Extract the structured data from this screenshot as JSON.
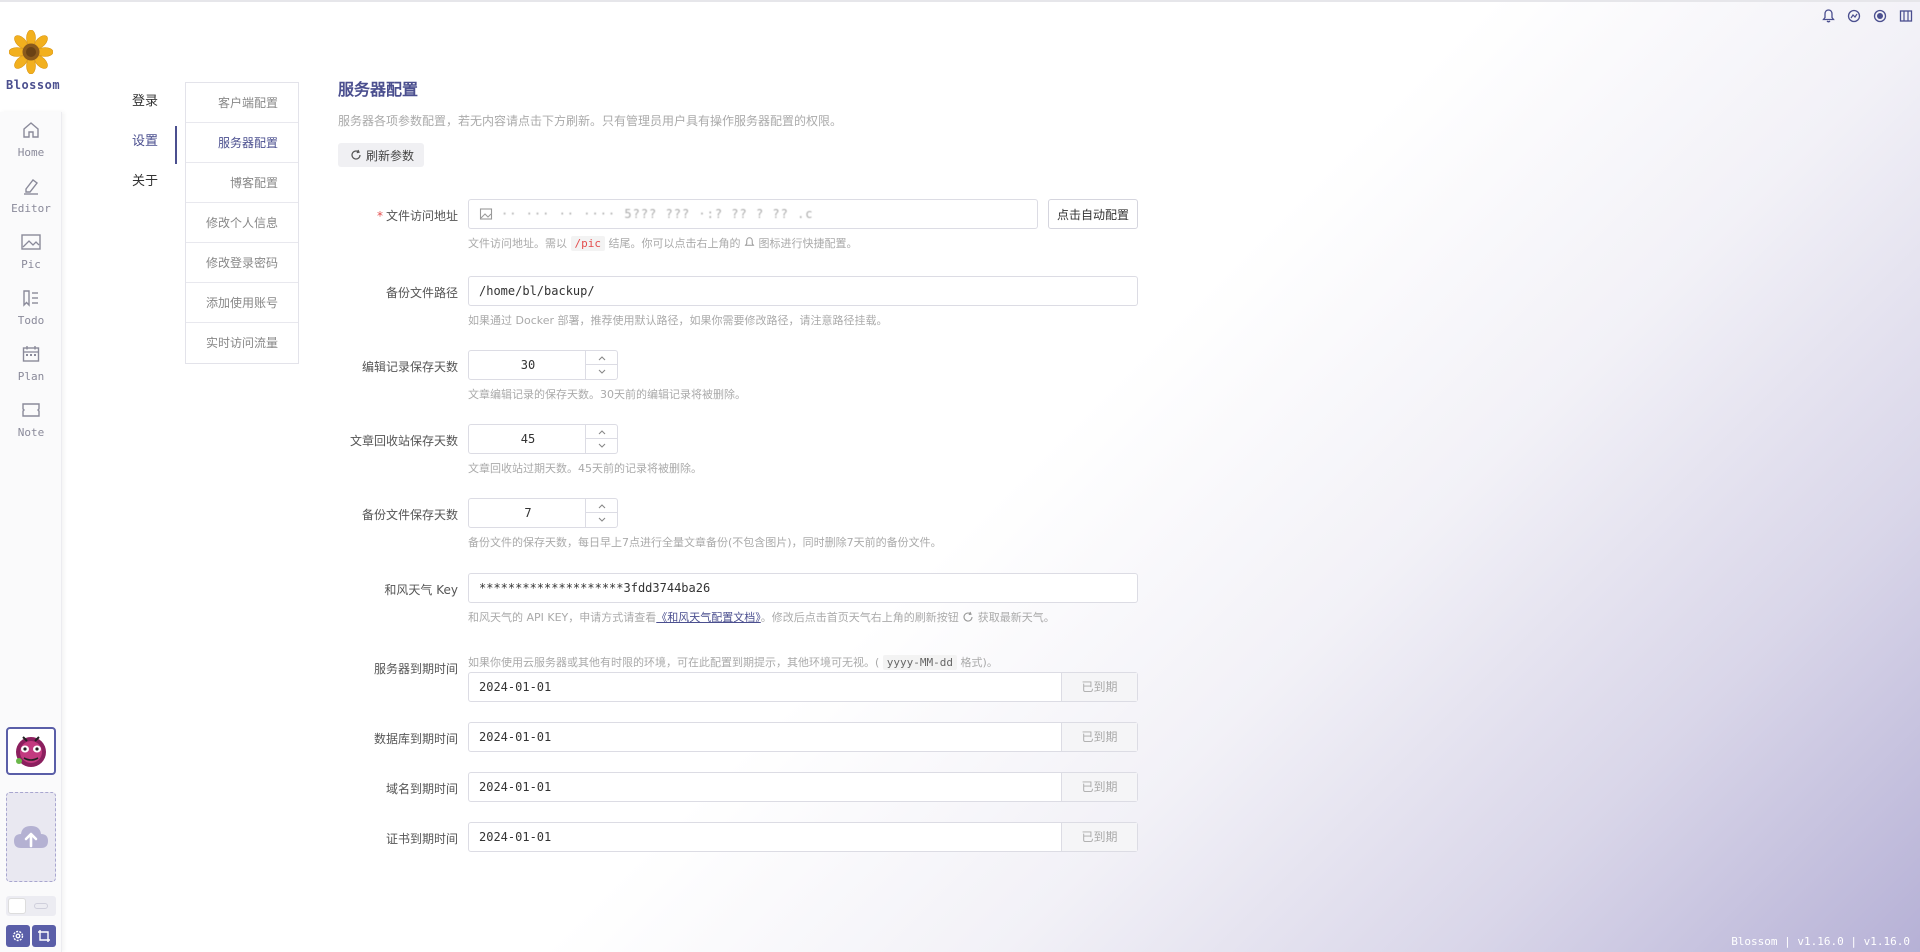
{
  "app": {
    "name": "Blossom",
    "version_text": "Blossom | v1.16.0 | v1.16.0"
  },
  "dock": {
    "items": [
      {
        "label": "Home",
        "icon": "home-icon"
      },
      {
        "label": "Editor",
        "icon": "editor-icon"
      },
      {
        "label": "Pic",
        "icon": "picture-icon"
      },
      {
        "label": "Todo",
        "icon": "todo-icon"
      },
      {
        "label": "Plan",
        "icon": "calendar-icon"
      },
      {
        "label": "Note",
        "icon": "note-icon"
      }
    ]
  },
  "main_menu": [
    "登录",
    "设置",
    "关于"
  ],
  "sub_menu": [
    "客户端配置",
    "服务器配置",
    "博客配置",
    "修改个人信息",
    "修改登录密码",
    "添加使用账号",
    "实时访问流量"
  ],
  "page": {
    "title": "服务器配置",
    "description": "服务器各项参数配置，若无内容请点击下方刷新。只有管理员用户具有操作服务器配置的权限。",
    "refresh_label": "刷新参数"
  },
  "form": {
    "file_url": {
      "label": "文件访问地址",
      "value": "··  ··· ·· ···· 5??? ??? ·:? ?? ? ?? .c",
      "button": "点击自动配置",
      "help_before": "文件访问地址。需以",
      "help_code": "/pic",
      "help_after": "结尾。你可以点击右上角的",
      "help_after2": "图标进行快捷配置。"
    },
    "backup_path": {
      "label": "备份文件路径",
      "value": "/home/bl/backup/",
      "help": "如果通过 Docker 部署，推荐使用默认路径，如果你需要修改路径，请注意路径挂载。"
    },
    "edit_days": {
      "label": "编辑记录保存天数",
      "value": "30",
      "help": "文章编辑记录的保存天数。30天前的编辑记录将被删除。"
    },
    "recycle_days": {
      "label": "文章回收站保存天数",
      "value": "45",
      "help": "文章回收站过期天数。45天前的记录将被删除。"
    },
    "backup_days": {
      "label": "备份文件保存天数",
      "value": "7",
      "help": "备份文件的保存天数，每日早上7点进行全量文章备份(不包含图片)，同时删除7天前的备份文件。"
    },
    "weather_key": {
      "label": "和风天气 Key",
      "value": "********************3fdd3744ba26",
      "help_before": "和风天气的 API KEY，申请方式请查看",
      "help_link": "《和风天气配置文档》",
      "help_after": "。修改后点击首页天气右上角的刷新按钮",
      "help_after2": "获取最新天气。"
    },
    "server_expire": {
      "label": "服务器到期时间",
      "help_before": "如果你使用云服务器或其他有时限的环境，可在此配置到期提示，其他环境可无视。(",
      "help_code": "yyyy-MM-dd",
      "help_after": "格式)。",
      "value": "2024-01-01",
      "status": "已到期"
    },
    "db_expire": {
      "label": "数据库到期时间",
      "value": "2024-01-01",
      "status": "已到期"
    },
    "domain_expire": {
      "label": "域名到期时间",
      "value": "2024-01-01",
      "status": "已到期"
    },
    "cert_expire": {
      "label": "证书到期时间",
      "value": "2024-01-01",
      "status": "已到期"
    }
  },
  "colors": {
    "accent": "#4b4f8f",
    "required": "#e34d4d"
  }
}
